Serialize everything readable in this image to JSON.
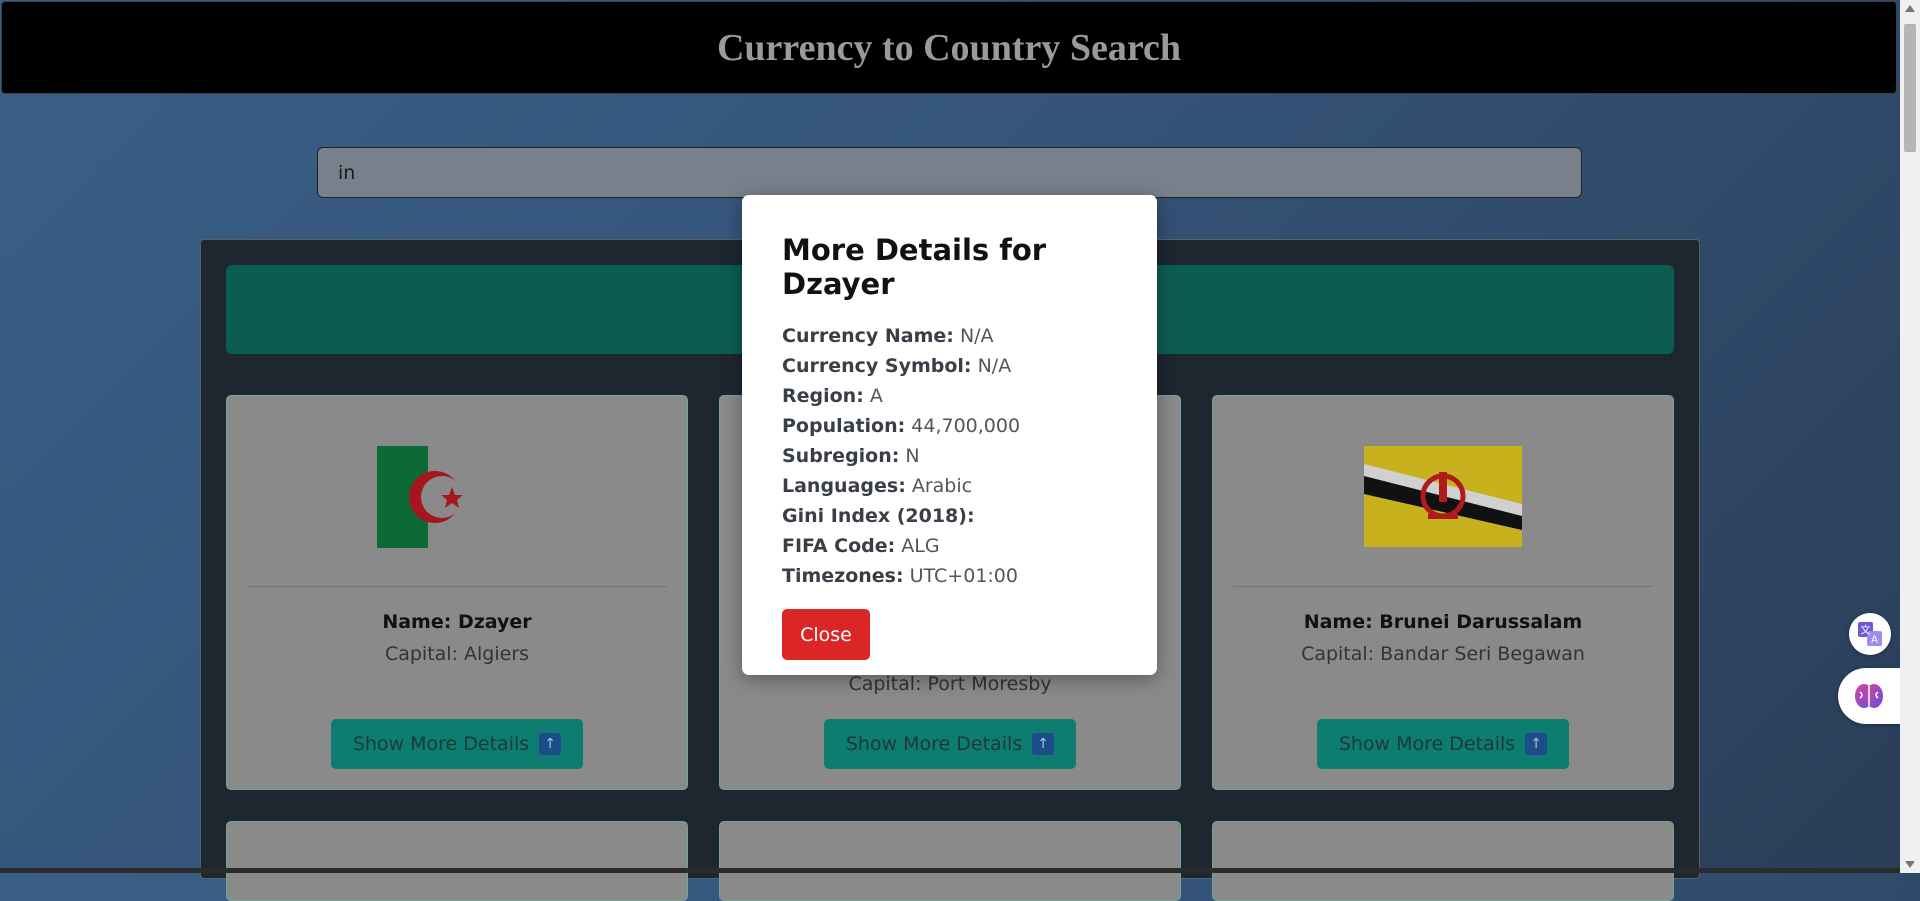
{
  "header": {
    "title": "Currency to Country Search"
  },
  "search": {
    "value": "in"
  },
  "cards": [
    {
      "name_label": "Name: Dzayer",
      "capital_label": "Capital: Algiers",
      "button_label": "Show More Details"
    },
    {
      "name_label": "",
      "capital_label": "Capital: Port Moresby",
      "button_label": "Show More Details"
    },
    {
      "name_label": "Name: Brunei Darussalam",
      "capital_label": "Capital: Bandar Seri Begawan",
      "button_label": "Show More Details"
    }
  ],
  "modal": {
    "title": "More Details for Dzayer",
    "rows": [
      {
        "label": "Currency Name:",
        "value": "N/A"
      },
      {
        "label": "Currency Symbol:",
        "value": "N/A"
      },
      {
        "label": "Region:",
        "value": "A"
      },
      {
        "label": "Population:",
        "value": "44,700,000"
      },
      {
        "label": "Subregion:",
        "value": "N"
      },
      {
        "label": "Languages:",
        "value": "Arabic"
      },
      {
        "label": "Gini Index (2018):",
        "value": ""
      },
      {
        "label": "FIFA Code:",
        "value": "ALG"
      },
      {
        "label": "Timezones:",
        "value": "UTC+01:00"
      }
    ],
    "close_label": "Close"
  },
  "colors": {
    "accent": "#0c7d70",
    "danger": "#dc2626",
    "banner": "#0b5d52"
  },
  "icons": [
    "arrow-up-icon",
    "translate-icon",
    "ai-brain-icon"
  ]
}
